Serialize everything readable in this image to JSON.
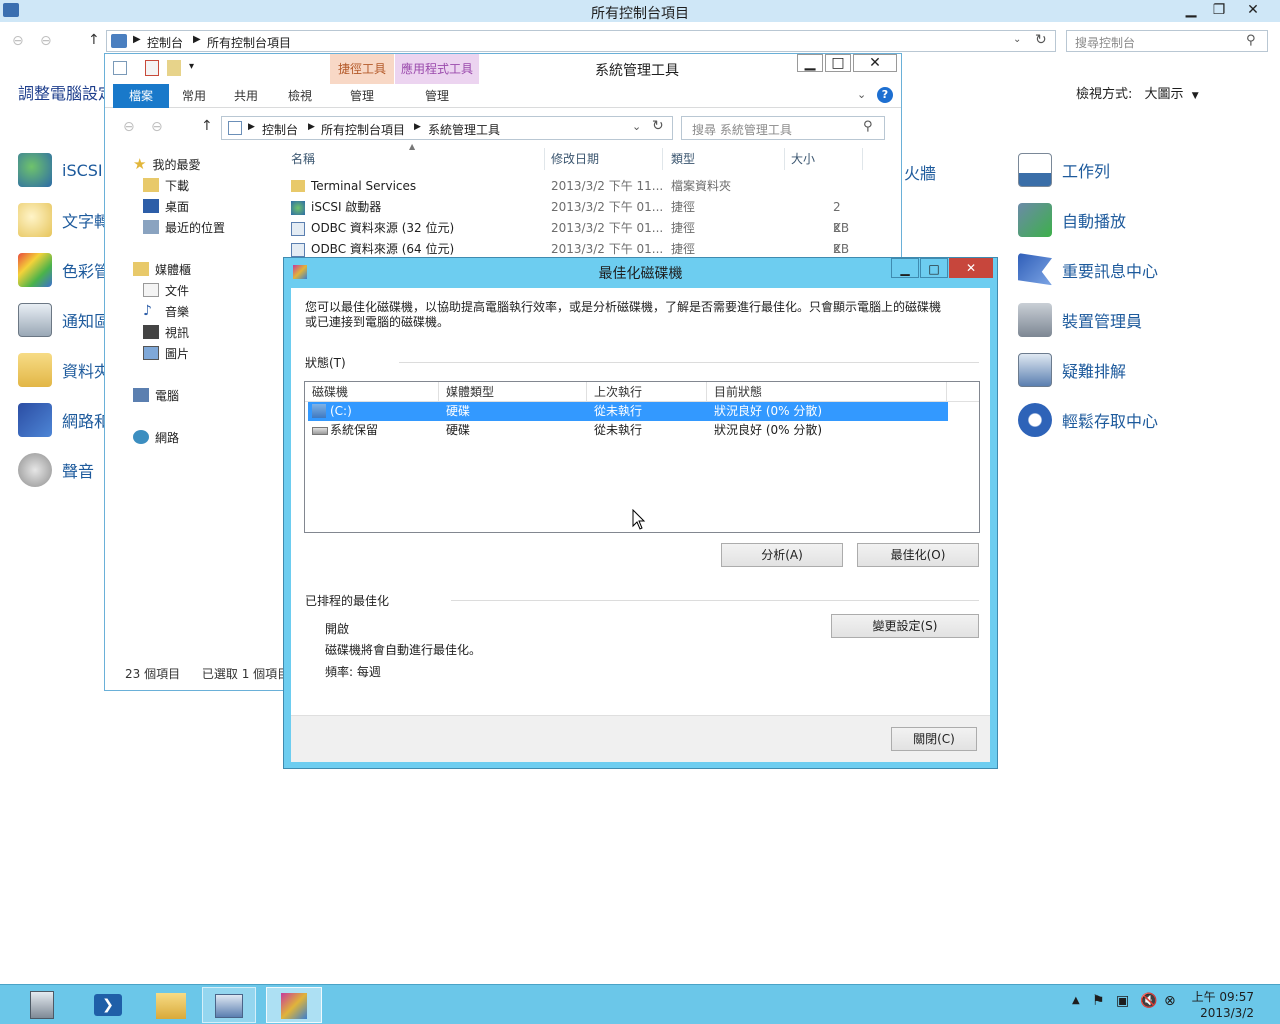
{
  "control_panel": {
    "title": "所有控制台項目",
    "breadcrumb": [
      "控制台",
      "所有控制台項目"
    ],
    "search_placeholder": "搜尋控制台",
    "heading": "調整電腦設定",
    "view_by_label": "檢視方式:",
    "view_by_value": "大圖示",
    "left_items": [
      "iSCSI",
      "文字轉",
      "色彩管",
      "通知區",
      "資料夾",
      "網路和",
      "聲音"
    ],
    "mid_partial": "火牆",
    "right_items": [
      "工作列",
      "自動播放",
      "重要訊息中心",
      "裝置管理員",
      "疑難排解",
      "輕鬆存取中心"
    ]
  },
  "admin_tools": {
    "title": "系統管理工具",
    "contextual_tabs": [
      "捷徑工具",
      "應用程式工具"
    ],
    "ribbon_tabs": [
      "檔案",
      "常用",
      "共用",
      "檢視",
      "管理",
      "管理"
    ],
    "breadcrumb": [
      "控制台",
      "所有控制台項目",
      "系統管理工具"
    ],
    "search_placeholder": "搜尋 系統管理工具",
    "nav_tree": [
      {
        "label": "我的最愛",
        "icon": "star-icon"
      },
      {
        "label": "下載",
        "icon": "download-folder-icon"
      },
      {
        "label": "桌面",
        "icon": "desktop-icon"
      },
      {
        "label": "最近的位置",
        "icon": "recent-icon"
      },
      {
        "label": "媒體櫃",
        "icon": "library-icon"
      },
      {
        "label": "文件",
        "icon": "document-icon"
      },
      {
        "label": "音樂",
        "icon": "music-icon"
      },
      {
        "label": "視訊",
        "icon": "video-icon"
      },
      {
        "label": "圖片",
        "icon": "picture-icon"
      },
      {
        "label": "電腦",
        "icon": "computer-icon"
      },
      {
        "label": "網路",
        "icon": "network-icon"
      }
    ],
    "columns": [
      "名稱",
      "修改日期",
      "類型",
      "大小"
    ],
    "files": [
      {
        "name": "Terminal Services",
        "date": "2013/3/2 下午 11...",
        "type": "檔案資料夾",
        "size": ""
      },
      {
        "name": "iSCSI 啟動器",
        "date": "2013/3/2 下午 01...",
        "type": "捷徑",
        "size": "2 KB"
      },
      {
        "name": "ODBC 資料來源 (32 位元)",
        "date": "2013/3/2 下午 01...",
        "type": "捷徑",
        "size": "2 KB"
      },
      {
        "name": "ODBC 資料來源 (64 位元)",
        "date": "2013/3/2 下午 01...",
        "type": "捷徑",
        "size": "2 KB"
      }
    ],
    "status_count": "23 個項目",
    "status_selected": "已選取 1 個項目"
  },
  "defrag": {
    "title": "最佳化磁碟機",
    "description": "您可以最佳化磁碟機，以協助提高電腦執行效率，或是分析磁碟機，了解是否需要進行最佳化。只會顯示電腦上的磁碟機或已連接到電腦的磁碟機。",
    "status_label": "狀態(T)",
    "columns": [
      "磁碟機",
      "媒體類型",
      "上次執行",
      "目前狀態"
    ],
    "drives": [
      {
        "drive": "(C:)",
        "media": "硬碟",
        "last_run": "從未執行",
        "status": "狀況良好 (0% 分散)"
      },
      {
        "drive": "系統保留",
        "media": "硬碟",
        "last_run": "從未執行",
        "status": "狀況良好 (0% 分散)"
      }
    ],
    "analyze_button": "分析(A)",
    "optimize_button": "最佳化(O)",
    "scheduled_label": "已排程的最佳化",
    "schedule_state": "開啟",
    "schedule_desc": "磁碟機將會自動進行最佳化。",
    "schedule_freq": "頻率: 每週",
    "change_settings_button": "變更設定(S)",
    "close_button": "關閉(C)"
  },
  "taskbar": {
    "time": "上午 09:57",
    "date": "2013/3/2"
  },
  "colors": {
    "selection": "#3399ff",
    "dialog_frame": "#6dcdf0",
    "taskbar": "#6bc7e9",
    "link": "#1d5a9c"
  }
}
